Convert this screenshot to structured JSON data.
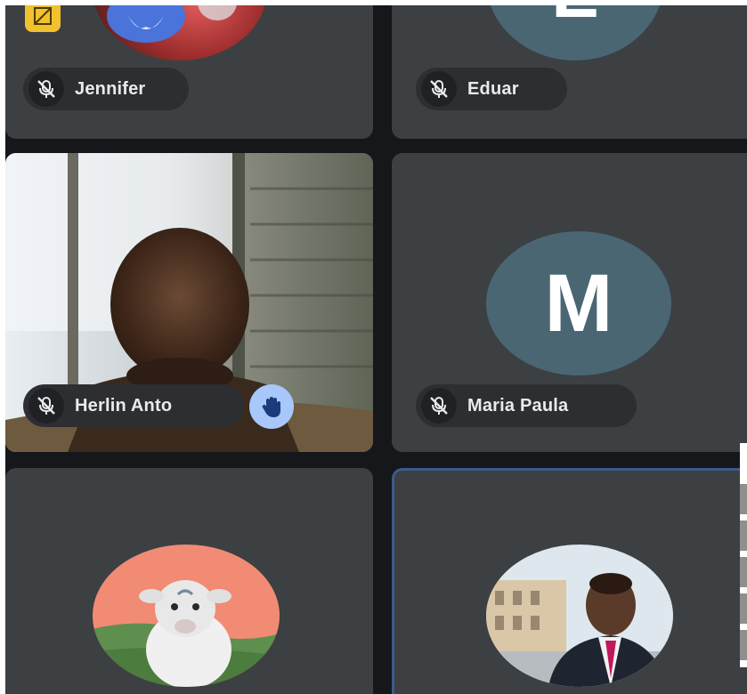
{
  "participants": [
    {
      "name": "Jennifer"
    },
    {
      "name": "Eduar",
      "avatar_letter": "E"
    },
    {
      "name": "Herlin Anto"
    },
    {
      "name": "Maria Paula",
      "avatar_letter": "M"
    }
  ],
  "icons": {
    "muted": "mic-off-icon",
    "hand": "raised-hand-icon",
    "sketch": "sketch-icon"
  },
  "colors": {
    "stage_bg": "#15171a",
    "tile_bg": "#3c4043",
    "pill_bg": "#2c2e31",
    "avatar_bg": "#4a6673",
    "hand_badge_bg": "#a8c7fa",
    "active_border": "#3d5a8a",
    "sketch_badge": "#f2c12e"
  }
}
